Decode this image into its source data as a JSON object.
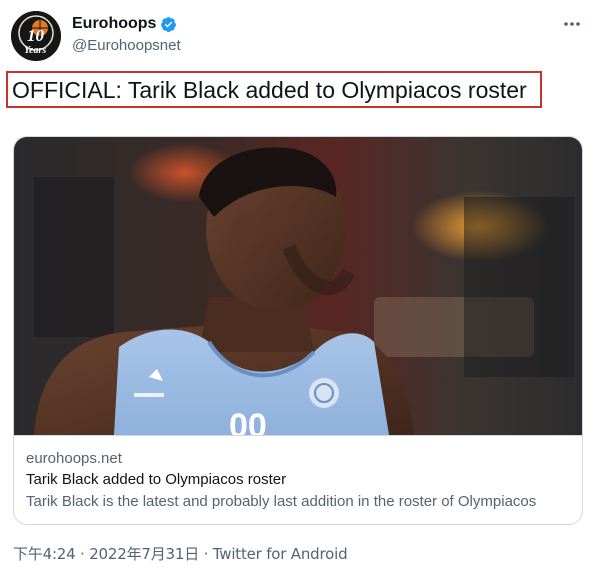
{
  "author": {
    "display_name": "Eurohoops",
    "handle": "@Eurohoopsnet",
    "avatar_icon": "eurohoops-10-years-logo",
    "avatar_text_main": "10",
    "avatar_text_sub": "Years",
    "verified_icon": "verified-badge-icon"
  },
  "tweet": {
    "text": "OFFICIAL: Tarik Black added to Olympiacos roster",
    "highlight_color": "#c5352f"
  },
  "card": {
    "image_icon": "player-photo",
    "domain": "eurohoops.net",
    "title": "Tarik Black added to Olympiacos roster",
    "description": "Tarik Black is the latest and probably last addition in the roster of Olympiacos"
  },
  "meta": {
    "time": "下午4:24",
    "separator1": "·",
    "date": "2022年7月31日",
    "separator2": "·",
    "source": "Twitter for Android"
  },
  "colors": {
    "accent": "#1d9bf0",
    "secondary_text": "#536471",
    "border": "#cfd9de"
  }
}
